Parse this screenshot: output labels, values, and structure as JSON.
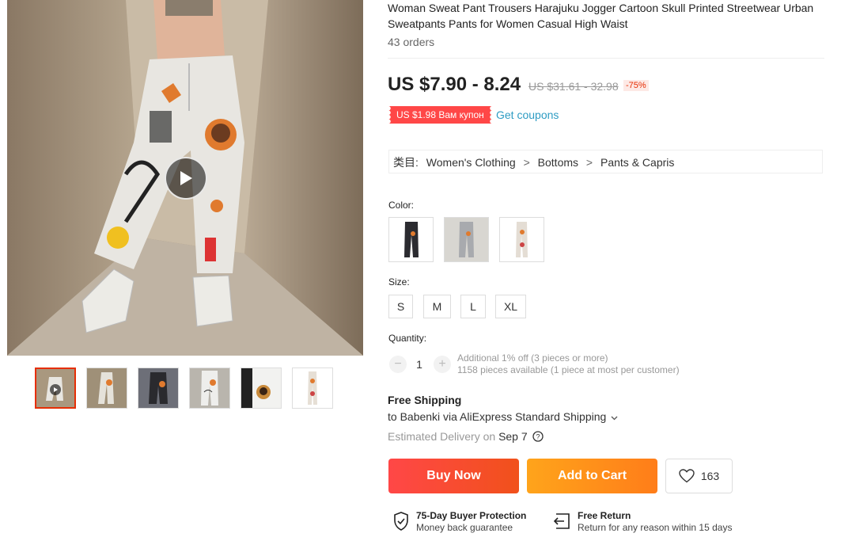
{
  "product": {
    "title": "Woman Sweat Pant Trousers Harajuku Jogger Cartoon Skull Printed Streetwear Urban Sweatpants Pants for Women Casual High Waist",
    "orders": "43 orders",
    "price": "US $7.90 - 8.24",
    "old_price": "US $31.61 - 32.98",
    "discount": "-75%",
    "coupon": "US $1.98 Вам купон",
    "get_coupons": "Get coupons"
  },
  "category": {
    "label": "类目:",
    "items": [
      "Women's Clothing",
      "Bottoms",
      "Pants & Capris"
    ],
    "separator": ">"
  },
  "options": {
    "color_label": "Color:",
    "size_label": "Size:",
    "sizes": [
      "S",
      "M",
      "L",
      "XL"
    ],
    "quantity_label": "Quantity:",
    "quantity": "1",
    "minus": "−",
    "plus": "+",
    "quantity_info_1": "Additional 1% off (3 pieces or more)",
    "quantity_info_2": "1158 pieces available (1 piece at most per customer)"
  },
  "shipping": {
    "title": "Free Shipping",
    "to": "to Babenki via AliExpress Standard Shipping",
    "delivery_prefix": "Estimated Delivery on",
    "delivery_date": "Sep 7"
  },
  "actions": {
    "buy_now": "Buy Now",
    "add_to_cart": "Add to Cart",
    "wishlist_count": "163"
  },
  "guarantees": [
    {
      "title": "75-Day Buyer Protection",
      "sub": "Money back guarantee",
      "icon": "shield-check-icon"
    },
    {
      "title": "Free Return",
      "sub": "Return for any reason within 15 days",
      "icon": "return-icon"
    }
  ],
  "colors": {
    "accent": "#ff4747",
    "link": "#2e9cc3",
    "cart": "#ff9a1b"
  }
}
